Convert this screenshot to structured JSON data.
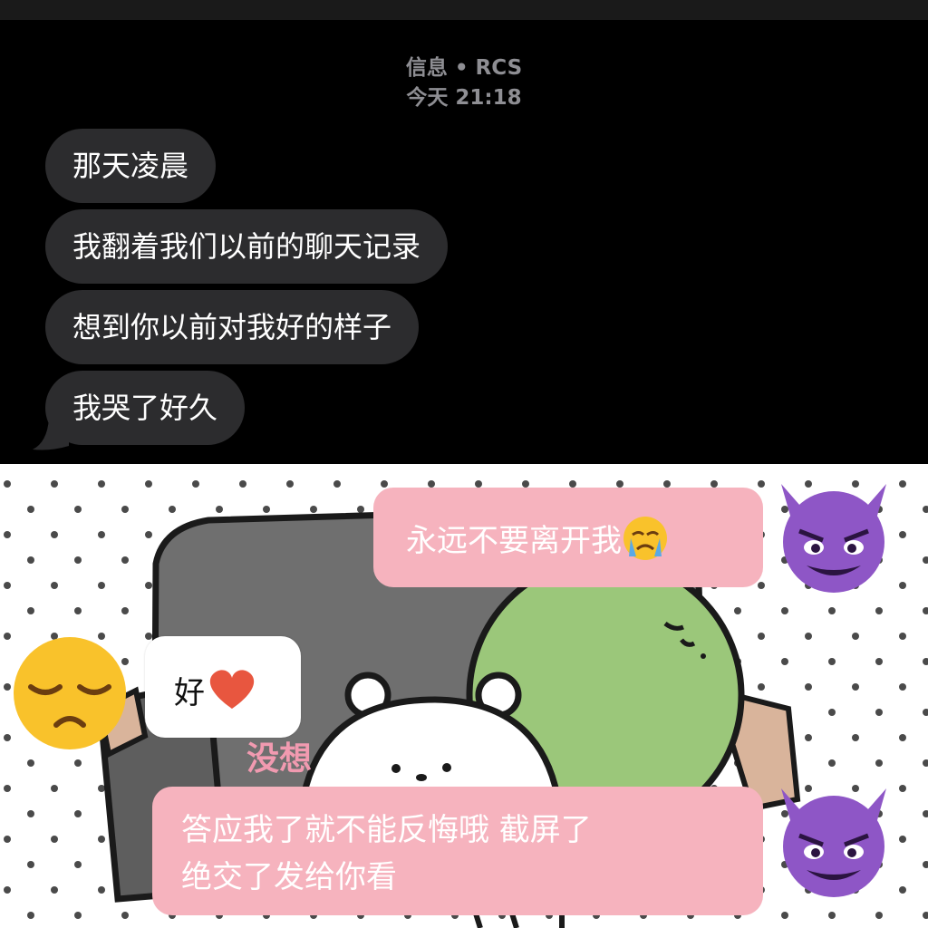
{
  "thread": {
    "service_line": "信息 • RCS",
    "time_line": "今天 21:18"
  },
  "messages": [
    {
      "text": "那天凌晨"
    },
    {
      "text": "我翻着我们以前的聊天记录"
    },
    {
      "text": "想到你以前对我好的样子"
    },
    {
      "text": "我哭了好久"
    }
  ],
  "meme": {
    "bubble_top": "永远不要离开我",
    "reply": "好",
    "caption": "没想",
    "bubble_bottom_line1": "答应我了就不能反悔哦 截屏了",
    "bubble_bottom_line2": "绝交了发给你看",
    "icons": [
      "devil-emoji-icon",
      "sad-face-emoji-icon",
      "crying-face-emoji-icon",
      "red-heart-icon"
    ]
  },
  "colors": {
    "dark_bubble": "#2c2c2e",
    "pink_bubble": "#f6b3be",
    "devil_purple": "#8e56c6",
    "emoji_yellow": "#f9c22b"
  }
}
